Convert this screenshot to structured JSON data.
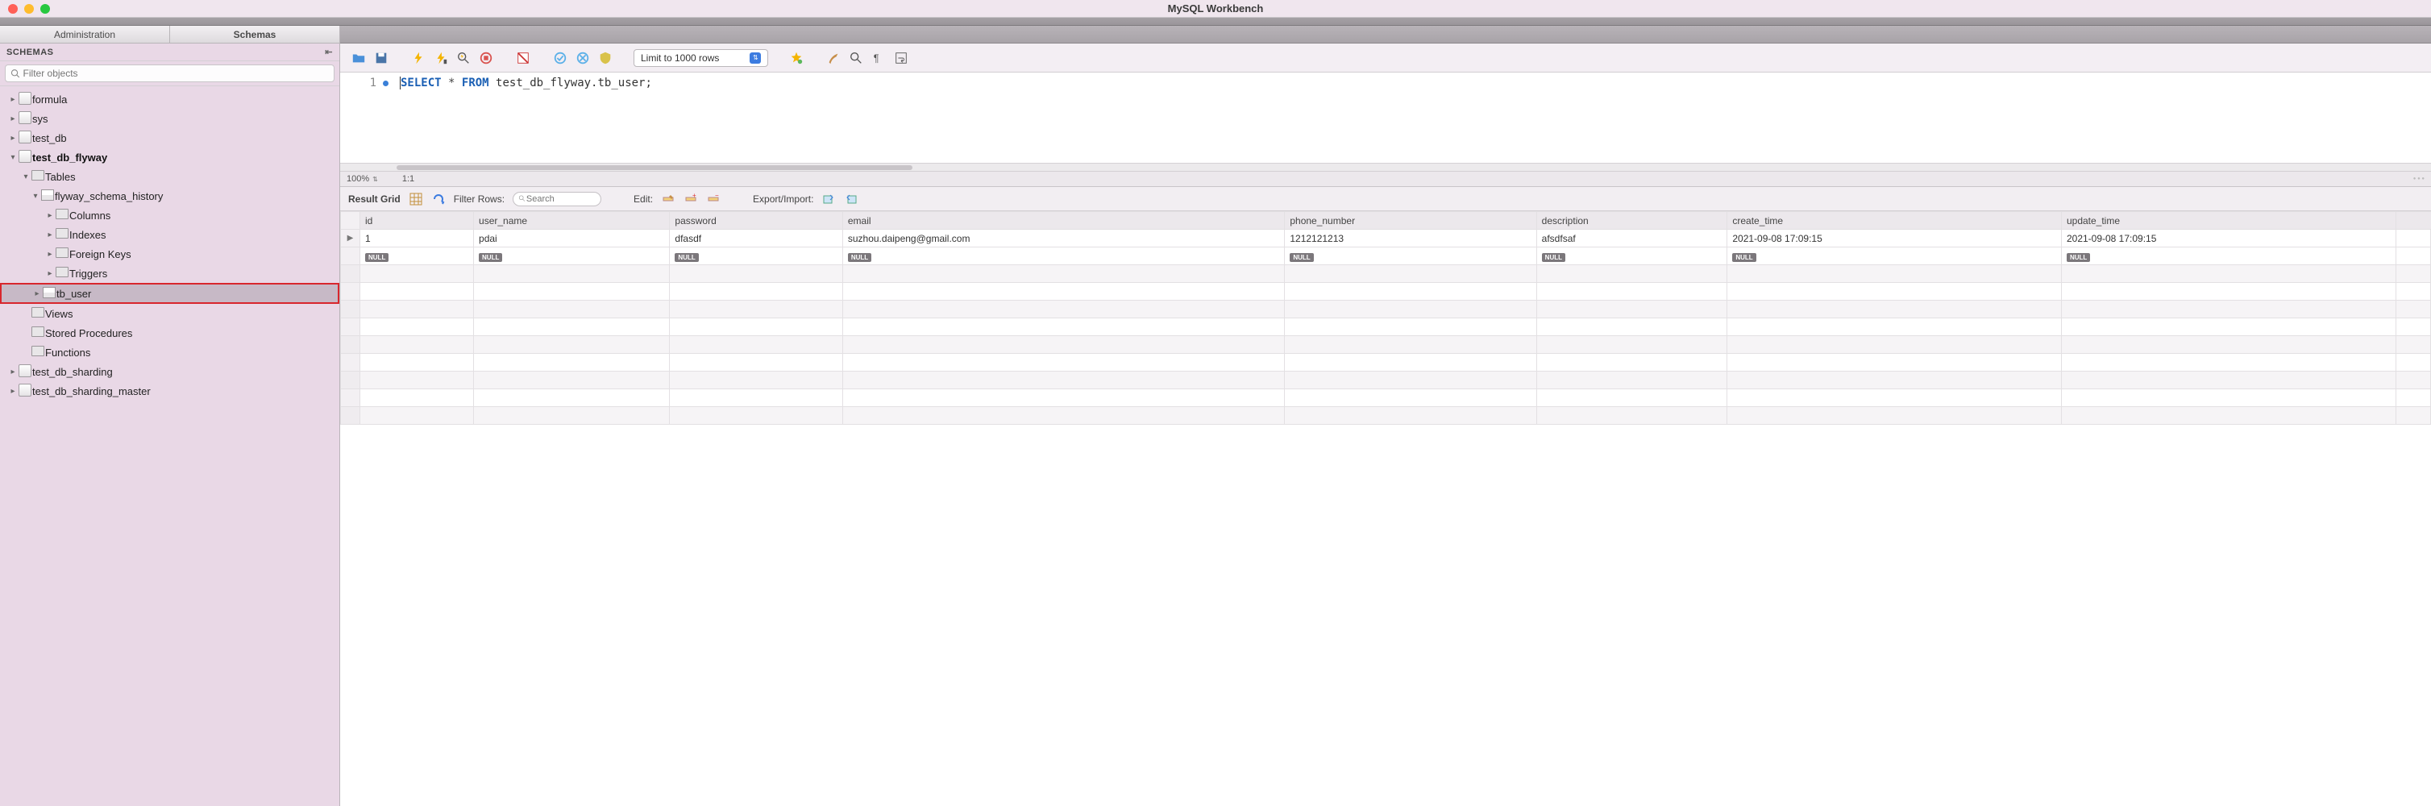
{
  "window": {
    "title": "MySQL Workbench"
  },
  "sidebar": {
    "tabs": {
      "admin": "Administration",
      "schemas": "Schemas"
    },
    "header": "SCHEMAS",
    "filter_placeholder": "Filter objects",
    "tree": {
      "formula": "formula",
      "sys": "sys",
      "test_db": "test_db",
      "test_db_flyway": "test_db_flyway",
      "tables": "Tables",
      "flyway_schema_history": "flyway_schema_history",
      "columns": "Columns",
      "indexes": "Indexes",
      "foreign_keys": "Foreign Keys",
      "triggers": "Triggers",
      "tb_user": "tb_user",
      "views": "Views",
      "stored_procedures": "Stored Procedures",
      "functions": "Functions",
      "test_db_sharding": "test_db_sharding",
      "test_db_sharding_master": "test_db_sharding_master"
    }
  },
  "toolbar": {
    "limit_label": "Limit to 1000 rows"
  },
  "editor": {
    "line_no": "1",
    "sql_select": "SELECT",
    "sql_star": "*",
    "sql_from": "FROM",
    "sql_rest": "test_db_flyway.tb_user;"
  },
  "editor_status": {
    "zoom": "100%",
    "pos": "1:1"
  },
  "result_toolbar": {
    "title": "Result Grid",
    "filter_label": "Filter Rows:",
    "filter_placeholder": "Search",
    "edit_label": "Edit:",
    "export_label": "Export/Import:"
  },
  "grid": {
    "columns": [
      "id",
      "user_name",
      "password",
      "email",
      "phone_number",
      "description",
      "create_time",
      "update_time"
    ],
    "rows": [
      {
        "id": "1",
        "user_name": "pdai",
        "password": "dfasdf",
        "email": "suzhou.daipeng@gmail.com",
        "phone_number": "1212121213",
        "description": "afsdfsaf",
        "create_time": "2021-09-08 17:09:15",
        "update_time": "2021-09-08 17:09:15"
      }
    ],
    "null_label": "NULL"
  }
}
